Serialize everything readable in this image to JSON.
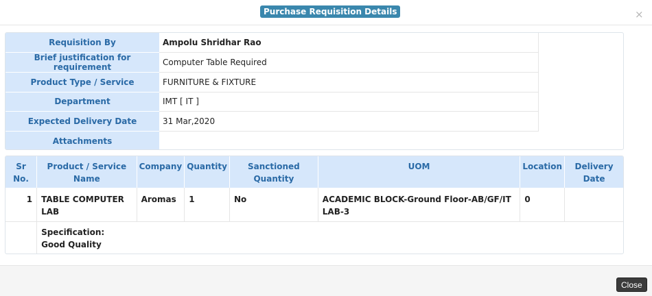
{
  "modal": {
    "title": "Purchase Requisition Details",
    "close_symbol": "×",
    "close_button_label": "Close"
  },
  "details": [
    {
      "label": "Requisition By",
      "value": "Ampolu Shridhar Rao"
    },
    {
      "label": "Brief justification for requirement",
      "value": "Computer Table Required"
    },
    {
      "label": "Product Type / Service",
      "value": "FURNITURE & FIXTURE"
    },
    {
      "label": "Department",
      "value": "IMT [ IT ]"
    },
    {
      "label": "Expected Delivery Date",
      "value": "31 Mar,2020"
    },
    {
      "label": "Attachments",
      "value": ""
    }
  ],
  "items_table": {
    "headers": [
      "Sr No.",
      "Product / Service Name",
      "Company",
      "Quantity",
      "Sanctioned Quantity",
      "UOM",
      "Location",
      "Delivery Date"
    ],
    "rows": [
      {
        "sr": "1",
        "product": "TABLE COMPUTER LAB",
        "company": "Aromas",
        "quantity": "1",
        "sanctioned": "No",
        "uom": "ACADEMIC BLOCK-Ground Floor-AB/GF/IT LAB-3",
        "location": "0",
        "delivery": ""
      }
    ],
    "specification_label": "Specification:",
    "specification_value": "Good Quality"
  },
  "colors": {
    "header_bg": "#d6e7fb",
    "header_text": "#2a6aa6",
    "title_badge": "#3a87ad",
    "close_button": "#3b3b3b"
  }
}
